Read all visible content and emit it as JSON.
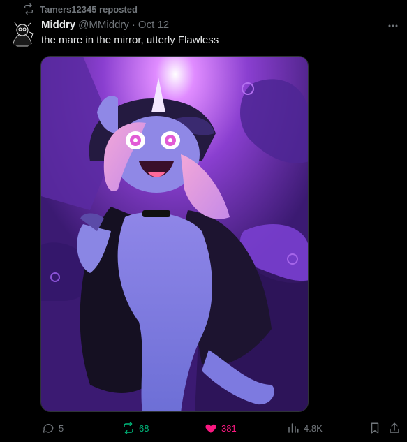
{
  "repost": {
    "icon": "repost-icon",
    "text": "Tamers12345 reposted"
  },
  "tweet": {
    "display_name": "Middry",
    "handle": "@MMiddry",
    "separator": "·",
    "date": "Oct 12",
    "text": "the mare in the mirror, utterly Flawless",
    "more_icon": "more-dots-icon"
  },
  "media": {
    "kind": "illustration"
  },
  "actions": {
    "replies": "5",
    "reposts": "68",
    "likes": "381",
    "views": "4.8K",
    "bookmark_icon": "bookmark-icon",
    "share_icon": "share-icon"
  },
  "colors": {
    "background": "#000000",
    "text_primary": "#e7e9ea",
    "text_secondary": "#71767b",
    "repost_active": "#00ba7c",
    "like_active": "#f91880"
  }
}
